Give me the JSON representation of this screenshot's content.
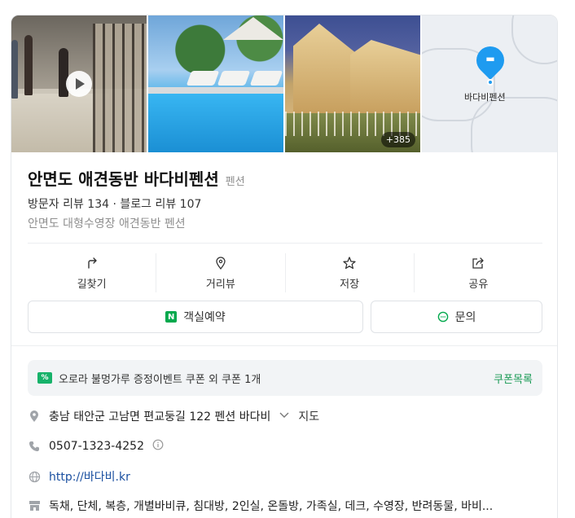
{
  "photos": {
    "more_count": "+385",
    "map_label": "바다비펜션"
  },
  "place": {
    "name": "안면도 애견동반 바다비펜션",
    "category": "펜션",
    "reviews": "방문자 리뷰 134 · 블로그 리뷰 107",
    "description": "안면도 대형수영장 애견동반 펜션"
  },
  "actions": [
    {
      "label": "길찾기",
      "icon": "directions-icon"
    },
    {
      "label": "거리뷰",
      "icon": "street-view-icon"
    },
    {
      "label": "저장",
      "icon": "star-icon"
    },
    {
      "label": "공유",
      "icon": "share-icon"
    }
  ],
  "buttons": {
    "book_label": "객실예약",
    "book_icon_letter": "N",
    "ask_label": "문의"
  },
  "coupon": {
    "icon_text": "%",
    "text": "오로라 불멍가루 증정이벤트 쿠폰 외 쿠폰 1개",
    "link": "쿠폰목록"
  },
  "info": {
    "address": "충남 태안군 고남면 편교둥길 122 펜션 바다비",
    "map_link": "지도",
    "phone": "0507-1323-4252",
    "website": "http://바다비.kr",
    "amenities": "독채, 단체, 복층, 개별바비큐, 침대방, 2인실, 온돌방, 가족실, 데크, 수영장, 반려동물, 바비..."
  },
  "colors": {
    "brand_green": "#03a94d",
    "map_pin": "#1e9bf0",
    "link_blue": "#1a4fa0"
  }
}
